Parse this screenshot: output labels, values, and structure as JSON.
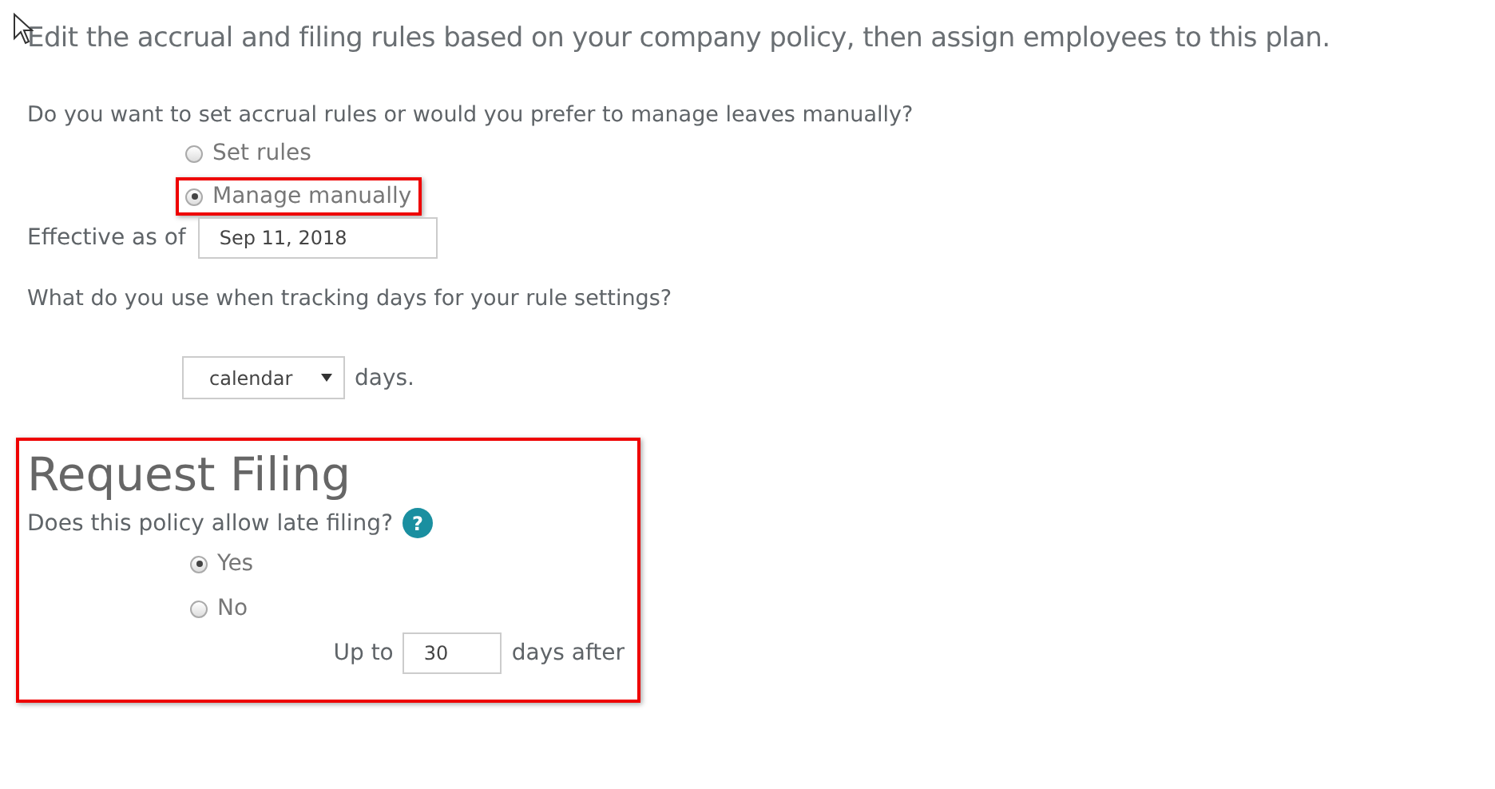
{
  "heading": "Edit the accrual and filing rules based on your company policy, then assign employees to this plan.",
  "accrual": {
    "question": "Do you want to set accrual rules or would you prefer to manage leaves manually?",
    "options": [
      {
        "label": "Set rules",
        "selected": false,
        "highlighted": false
      },
      {
        "label": "Manage manually",
        "selected": true,
        "highlighted": true
      }
    ],
    "effective_label": "Effective as of",
    "effective_value": "Sep 11, 2018"
  },
  "tracking": {
    "question": "What do you use when tracking days for your rule settings?",
    "select_value": "calendar",
    "suffix": "days."
  },
  "filing": {
    "title": "Request Filing",
    "highlighted": true,
    "question": "Does this policy allow late filing?",
    "help": "?",
    "options": [
      {
        "label": "Yes",
        "selected": true
      },
      {
        "label": "No",
        "selected": false
      }
    ],
    "prefix": "Up to",
    "value": "30",
    "suffix": "days after"
  }
}
